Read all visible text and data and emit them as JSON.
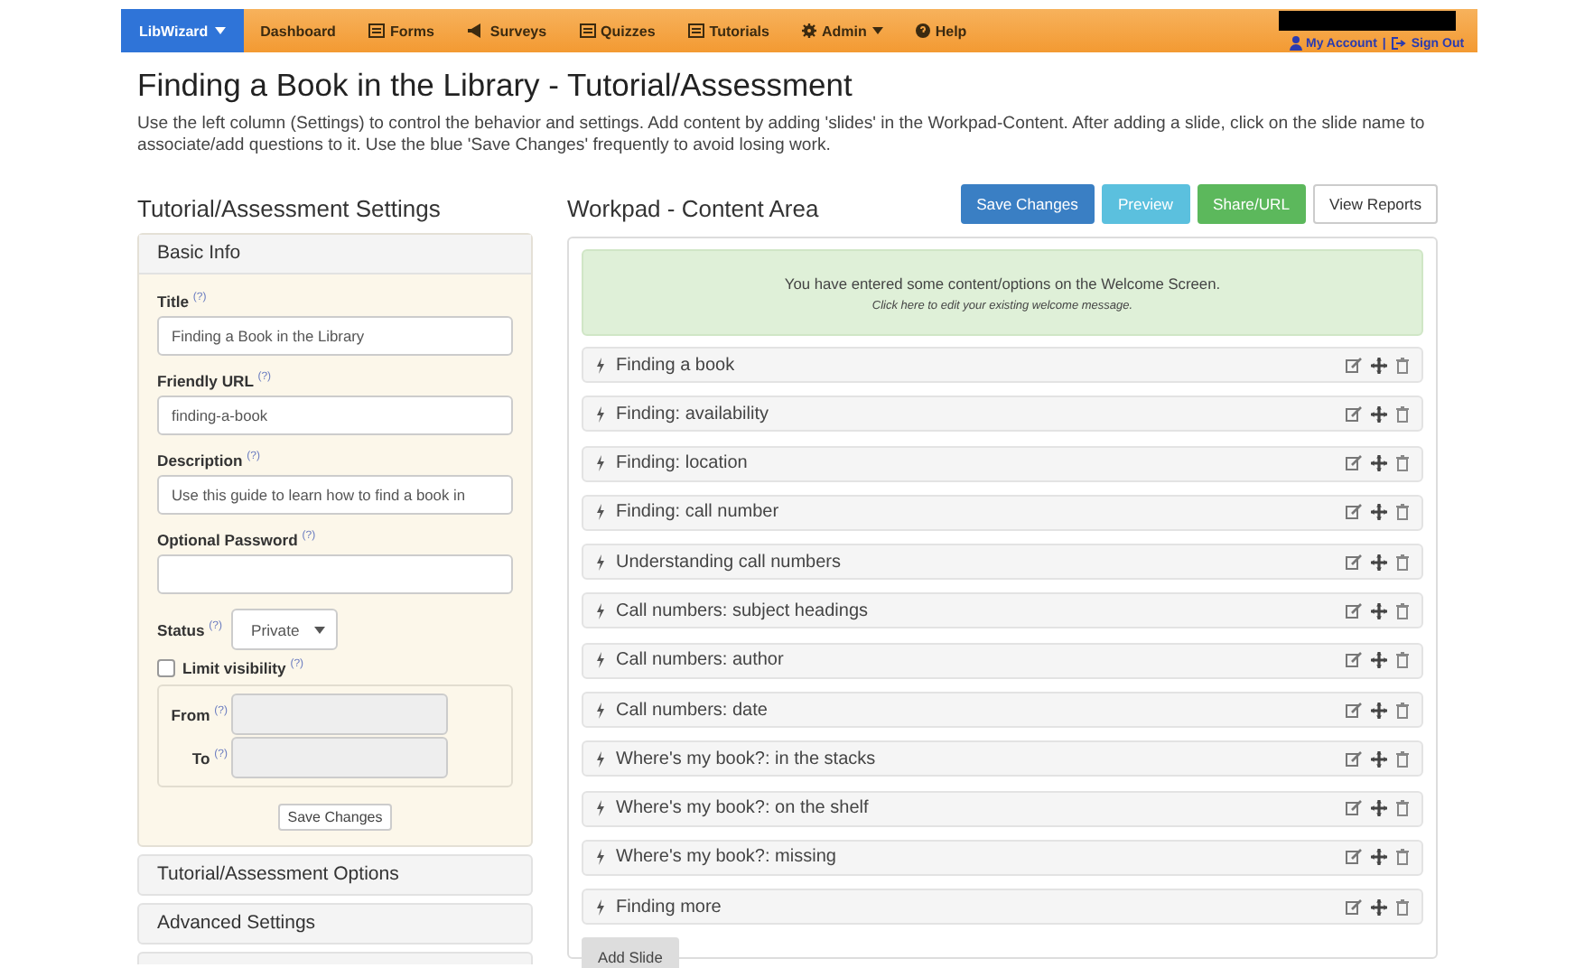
{
  "navbar": {
    "brand": {
      "label": "LibWizard",
      "selected": true,
      "dropdown": true
    },
    "items": [
      {
        "label": "Dashboard",
        "kind": "plain",
        "dropdown": false
      },
      {
        "label": "Forms",
        "kind": "list",
        "dropdown": false
      },
      {
        "label": "Surveys",
        "kind": "megaphone",
        "dropdown": false
      },
      {
        "label": "Quizzes",
        "kind": "list",
        "dropdown": false
      },
      {
        "label": "Tutorials",
        "kind": "list",
        "dropdown": false
      },
      {
        "label": "Admin",
        "kind": "gear",
        "dropdown": true
      },
      {
        "label": "Help",
        "kind": "help",
        "dropdown": false
      }
    ],
    "account": [
      {
        "label": "My Account",
        "kind": "user"
      },
      {
        "label": "Sign Out",
        "kind": "signout"
      }
    ],
    "separator": "|"
  },
  "page": {
    "title": "Finding a Book in the Library - Tutorial/Assessment",
    "intro": "Use the left column (Settings) to control the behavior and settings. Add content by adding 'slides' in the Workpad-Content. After adding a slide, click on the slide name to associate/add questions to it. Use the blue 'Save Changes' frequently to avoid losing work."
  },
  "settings": {
    "heading": "Tutorial/Assessment Settings",
    "basic_info": {
      "header": "Basic Info",
      "fields": [
        {
          "label": "Title",
          "help": "(?)",
          "value": "Finding a Book in the Library"
        },
        {
          "label": "Friendly URL",
          "help": "(?)",
          "value": "finding-a-book"
        },
        {
          "label": "Description",
          "help": "(?)",
          "value": "Use this guide to learn how to find a book in"
        },
        {
          "label": "Optional Password",
          "help": "(?)"
        }
      ],
      "status": {
        "label": "Status",
        "help": "(?)",
        "value": "Private"
      },
      "limit_visibility": {
        "label": "Limit visibility",
        "help": "(?)",
        "checked": false
      },
      "dates": [
        {
          "label": "From",
          "help": "(?)",
          "disabled": true
        },
        {
          "label": "To",
          "help": "(?)",
          "disabled": true
        }
      ],
      "save_button": "Save Changes"
    },
    "sections": [
      "Tutorial/Assessment Options",
      "Advanced Settings"
    ]
  },
  "workpad": {
    "heading": "Workpad - Content Area",
    "buttons": [
      {
        "label": "Save Changes",
        "kind": "primary"
      },
      {
        "label": "Preview",
        "kind": "info"
      },
      {
        "label": "Share/URL",
        "kind": "success"
      },
      {
        "label": "View Reports",
        "kind": "default"
      }
    ],
    "welcome": {
      "message": "You have entered some content/options on the Welcome Screen.",
      "link": "Click here to edit your existing welcome message."
    },
    "slides": [
      "Finding a book",
      "Finding: availability",
      "Finding: location",
      "Finding: call number",
      "Understanding call numbers",
      "Call numbers: subject headings",
      "Call numbers: author",
      "Call numbers: date",
      "Where's my book?: in the stacks",
      "Where's my book?: on the shelf",
      "Where's my book?: missing",
      "Finding more"
    ],
    "add_button": "Add Slide"
  }
}
